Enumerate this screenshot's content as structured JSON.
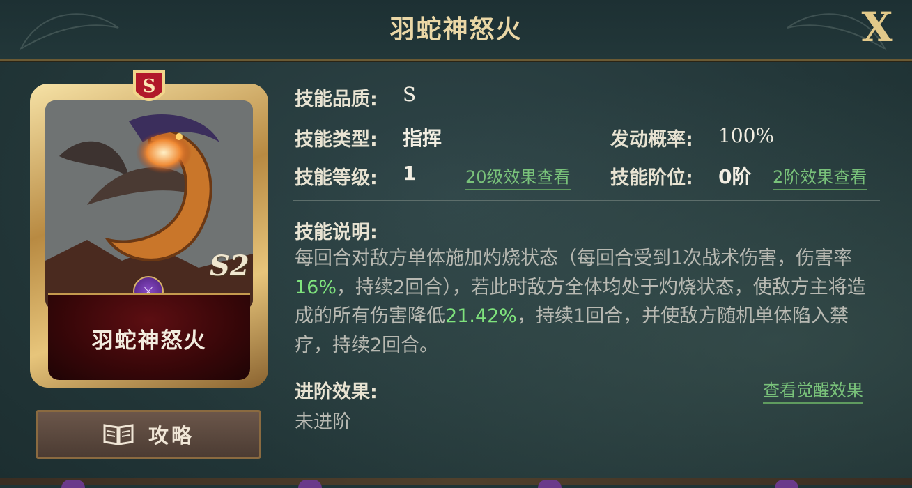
{
  "window": {
    "title": "羽蛇神怒火",
    "close_label": "X"
  },
  "card": {
    "grade": "S",
    "name": "羽蛇神怒火",
    "season": "S2",
    "faction_icon": "faction-emblem-icon",
    "guide_label": "攻略"
  },
  "info": {
    "quality_label": "技能品质:",
    "quality_value": "S",
    "type_label": "技能类型:",
    "type_value": "指挥",
    "chance_label": "发动概率:",
    "chance_value": "100%",
    "level_label": "技能等级:",
    "level_value": "1",
    "level_link": "20级效果查看",
    "rank_label": "技能阶位:",
    "rank_value": "0阶",
    "rank_link": "2阶效果查看"
  },
  "description": {
    "label": "技能说明:",
    "seg1": "每回合对敌方单体施加灼烧状态（每回合受到1次战术伤害，伤害率",
    "hl1": "16%",
    "seg2": "，持续2回合），若此时敌方全体均处于灼烧状态，使敌方主将造成的所有伤害降低",
    "hl2": "21.42%",
    "seg3": "，持续1回合，并使敌方随机单体陷入禁疗，持续2回合。"
  },
  "advance": {
    "label": "进阶效果:",
    "value": "未进阶",
    "link": "查看觉醒效果"
  },
  "colors": {
    "accent_gold": "#ead7a6",
    "link_green": "#79c27a",
    "highlight_green": "#7fe37d"
  }
}
